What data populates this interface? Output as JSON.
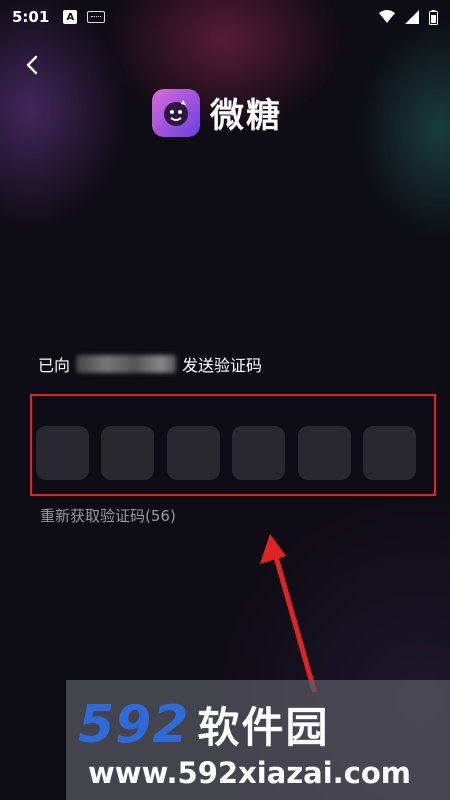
{
  "status_bar": {
    "time": "5:01",
    "a_badge": "A",
    "icons": [
      "notification-a-icon",
      "keyboard-icon",
      "wifi-icon",
      "signal-icon",
      "battery-icon"
    ]
  },
  "header": {
    "back_icon": "chevron-left-icon",
    "app_name": "微糖"
  },
  "verify": {
    "sent_prefix": "已向",
    "sent_suffix": "发送验证码",
    "resend_label": "重新获取验证码(56)"
  },
  "code_cells": [
    "",
    "",
    "",
    "",
    "",
    ""
  ],
  "watermark": {
    "digits": "592",
    "name": "软件园",
    "url": "www.592xiazai.com"
  },
  "colors": {
    "highlight_box": "#e02424",
    "cell_bg": "#2a282f",
    "watermark_blue": "#2f6bd8"
  }
}
